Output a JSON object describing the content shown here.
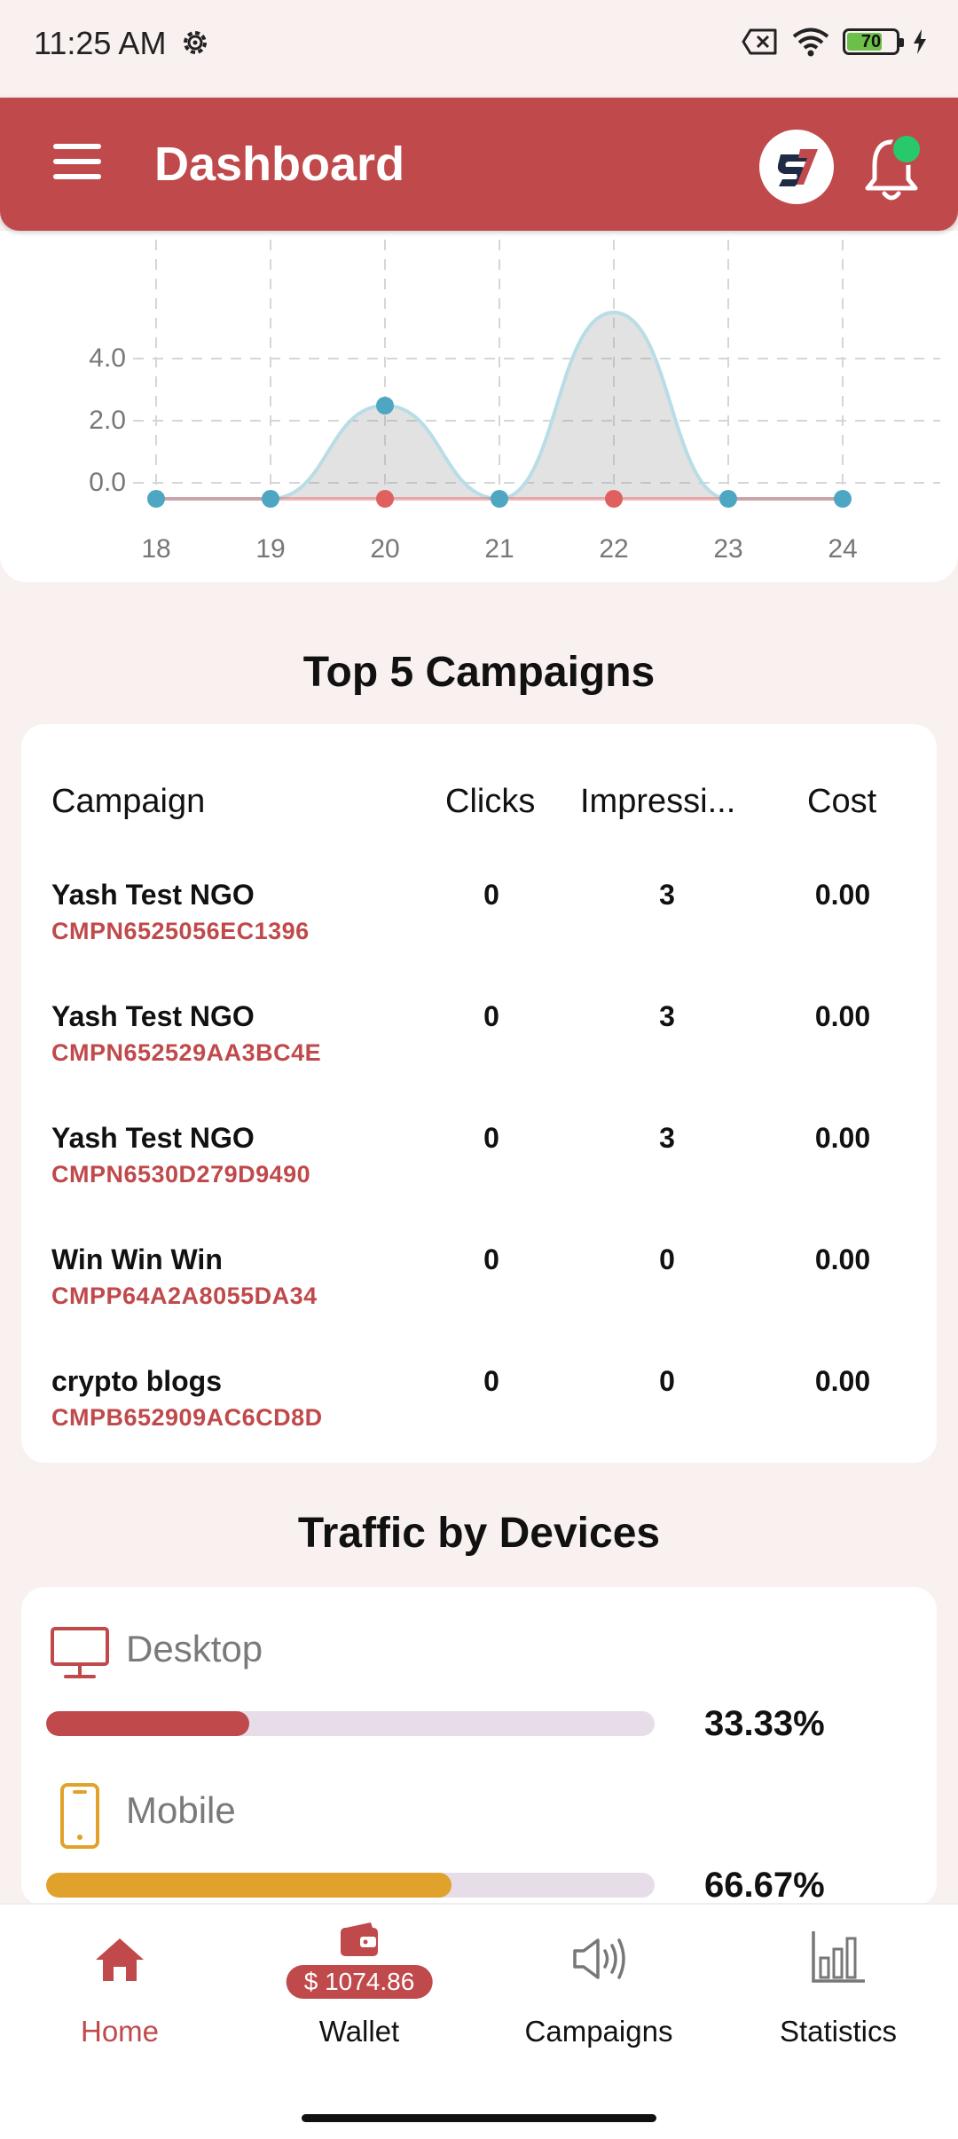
{
  "status_bar": {
    "time": "11:25 AM",
    "battery_level": "70",
    "icons": [
      "gear-icon",
      "sim-off-icon",
      "wifi-icon",
      "battery-icon",
      "charging-icon"
    ]
  },
  "header": {
    "title": "Dashboard",
    "icons": [
      "menu-icon",
      "brand-logo",
      "bell-icon"
    ],
    "notification_dot_color": "#27c96a"
  },
  "colors": {
    "primary": "#c0494b",
    "series_blue": "#4ea7c2",
    "series_red": "#e06060",
    "mobile_bar": "#e0a22a",
    "background": "#f9f0f0"
  },
  "chart_data": {
    "type": "area",
    "title": "",
    "xlabel": "",
    "ylabel": "",
    "x": [
      "18",
      "19",
      "20",
      "21",
      "22",
      "23",
      "24"
    ],
    "y_ticks": [
      "0.0",
      "2.0",
      "4.0"
    ],
    "grid": true,
    "series": [
      {
        "color": "#4ea7c2",
        "values": [
          0,
          0,
          3,
          0,
          6,
          0,
          0
        ]
      },
      {
        "color": "#e06060",
        "values": [
          0,
          0,
          0,
          0,
          0,
          0,
          0
        ]
      }
    ]
  },
  "campaigns": {
    "title": "Top 5 Campaigns",
    "headers": {
      "campaign": "Campaign",
      "clicks": "Clicks",
      "impressions": "Impressi...",
      "cost": "Cost"
    },
    "rows": [
      {
        "name": "Yash Test NGO",
        "id": "CMPN6525056EC1396",
        "clicks": "0",
        "impressions": "3",
        "cost": "0.00"
      },
      {
        "name": "Yash Test NGO",
        "id": "CMPN652529AA3BC4E",
        "clicks": "0",
        "impressions": "3",
        "cost": "0.00"
      },
      {
        "name": "Yash Test NGO",
        "id": "CMPN6530D279D9490",
        "clicks": "0",
        "impressions": "3",
        "cost": "0.00"
      },
      {
        "name": "Win Win Win",
        "id": "CMPP64A2A8055DA34",
        "clicks": "0",
        "impressions": "0",
        "cost": "0.00"
      },
      {
        "name": "crypto blogs",
        "id": "CMPB652909AC6CD8D",
        "clicks": "0",
        "impressions": "0",
        "cost": "0.00"
      }
    ]
  },
  "devices": {
    "title": "Traffic by Devices",
    "items": [
      {
        "label": "Desktop",
        "percent": "33.33%",
        "fraction": 0.3333,
        "icon": "desktop-icon",
        "color": "#c0494b"
      },
      {
        "label": "Mobile",
        "percent": "66.67%",
        "fraction": 0.6667,
        "icon": "mobile-icon",
        "color": "#e0a22a"
      }
    ]
  },
  "nav": {
    "items": [
      {
        "label": "Home",
        "icon": "home-icon",
        "active": true
      },
      {
        "label": "Wallet",
        "icon": "wallet-icon",
        "badge": "$ 1074.86"
      },
      {
        "label": "Campaigns",
        "icon": "megaphone-icon"
      },
      {
        "label": "Statistics",
        "icon": "bar-chart-icon"
      }
    ]
  }
}
